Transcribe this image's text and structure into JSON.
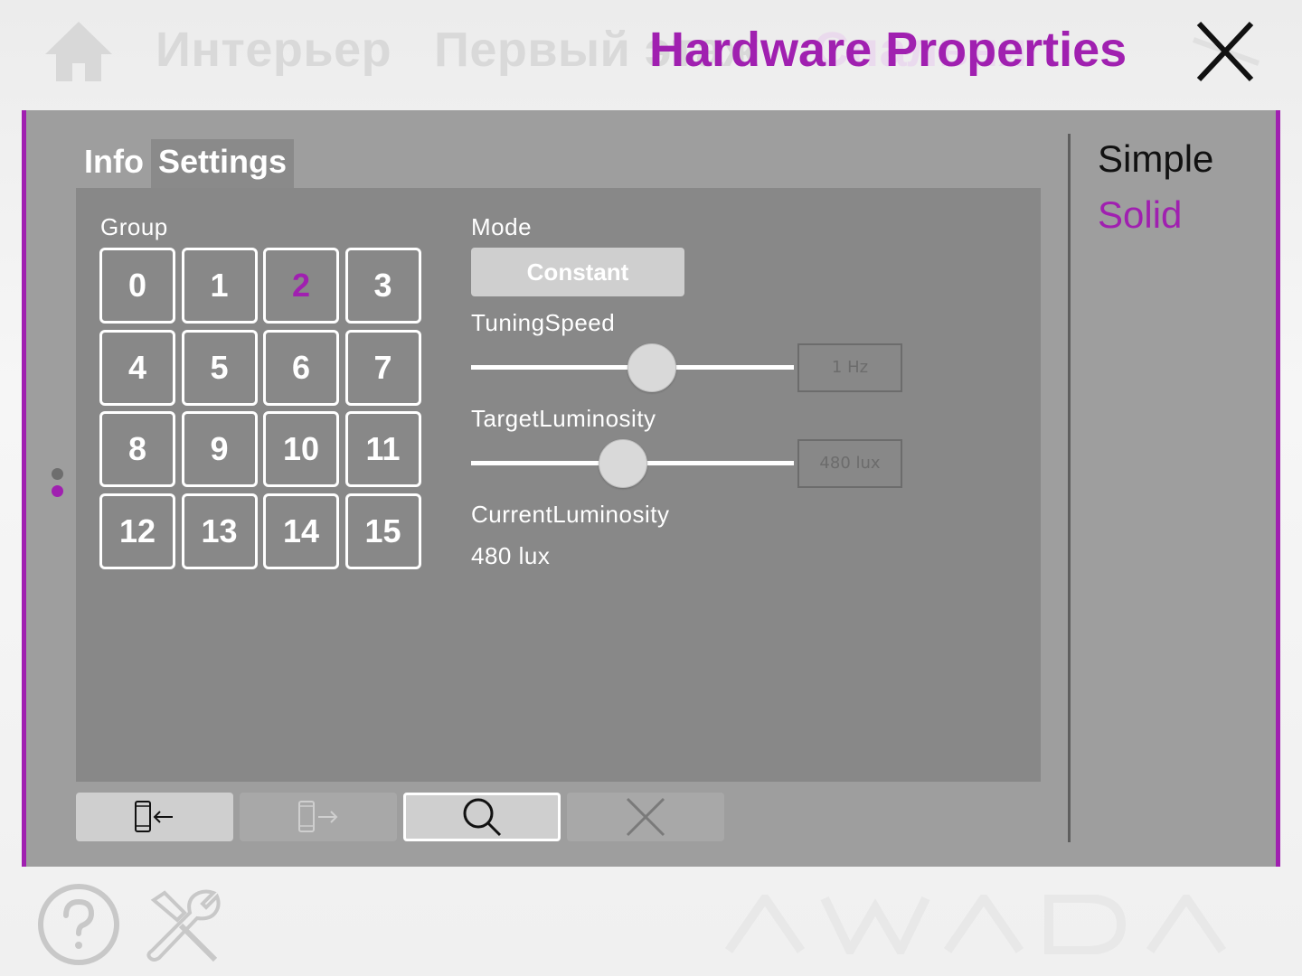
{
  "header": {
    "breadcrumbs": [
      "Интерьер",
      "Первый этаж"
    ],
    "background_text": "Спальня",
    "title": "Hardware Properties",
    "home_icon": "home-icon",
    "close_icon": "close-icon"
  },
  "tabs": [
    {
      "label": "Info",
      "active": false
    },
    {
      "label": "Settings",
      "active": true
    }
  ],
  "group": {
    "label": "Group",
    "buttons": [
      "0",
      "1",
      "2",
      "3",
      "4",
      "5",
      "6",
      "7",
      "8",
      "9",
      "10",
      "11",
      "12",
      "13",
      "14",
      "15"
    ],
    "selected": "2"
  },
  "mode": {
    "label": "Mode",
    "value": "Constant"
  },
  "tuning_speed": {
    "label": "TuningSpeed",
    "value": "1 Hz",
    "slider_fraction": 0.56
  },
  "target_luminosity": {
    "label": "TargetLuminosity",
    "value": "480 lux",
    "slider_fraction": 0.47
  },
  "current_luminosity": {
    "label": "CurrentLuminosity",
    "value": "480 lux"
  },
  "toolbar": [
    {
      "name": "import-from-device-button",
      "icon": "device-import-icon"
    },
    {
      "name": "export-to-device-button",
      "icon": "device-export-icon"
    },
    {
      "name": "search-button",
      "icon": "search-icon"
    },
    {
      "name": "delete-button",
      "icon": "close-icon"
    }
  ],
  "right_panel": {
    "items": [
      "Simple",
      "Solid"
    ],
    "selected": "Solid"
  },
  "footer": {
    "help_icon": "help-icon",
    "tools_icon": "tools-icon",
    "logo_text": "AWADA"
  },
  "colors": {
    "accent": "#a020b0",
    "panel": "#9e9e9e",
    "content": "#888888"
  }
}
